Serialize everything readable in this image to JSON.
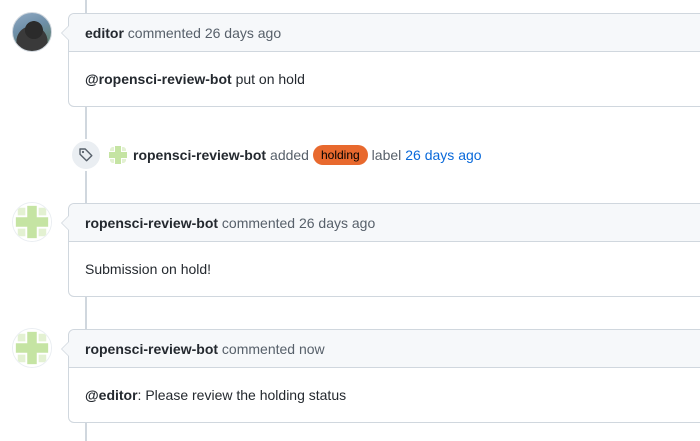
{
  "timeline": {
    "comments": [
      {
        "author": "editor",
        "action": "commented",
        "time": "26 days ago",
        "mention": "@ropensci-review-bot",
        "text": " put on hold"
      },
      {
        "author": "ropensci-review-bot",
        "action": "commented",
        "time": "26 days ago",
        "mention": "",
        "text": "Submission on hold!"
      },
      {
        "author": "ropensci-review-bot",
        "action": "commented",
        "time": "now",
        "mention": "@editor",
        "text": ": Please review the holding status"
      }
    ],
    "label_event": {
      "icon": "tag-icon",
      "author": "ropensci-review-bot",
      "verb": "added",
      "label": "holding",
      "label_color": "#e8692e",
      "suffix": "label",
      "time": "26 days ago"
    }
  },
  "colors": {
    "link": "#0969da",
    "border": "#d0d7de",
    "header_bg": "#f6f8fa",
    "bot_green": "#c5e4a3"
  }
}
